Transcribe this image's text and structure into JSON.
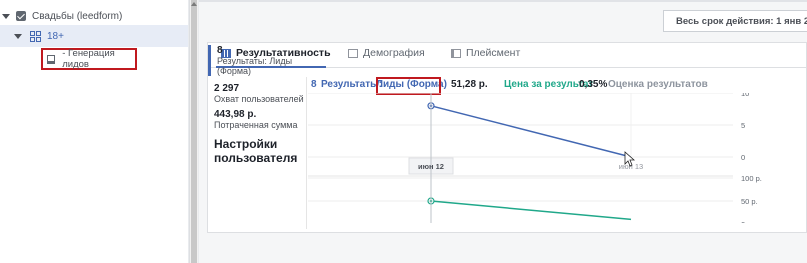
{
  "tree": {
    "campaign": "Свадьбы (leedform)",
    "adset": "18+",
    "ad": "- Генерация лидов"
  },
  "date_filter": "Весь срок действия: 1 янв 201",
  "tabs": [
    {
      "label": "Результативность",
      "active": true
    },
    {
      "label": "Демография",
      "active": false
    },
    {
      "label": "Плейсмент",
      "active": false
    }
  ],
  "metrics": [
    {
      "value": "8",
      "desc": "Результаты: Лиды (Форма)"
    },
    {
      "value": "2 297",
      "desc": "Охват пользователей"
    },
    {
      "value": "443,98 р.",
      "desc": "Потраченная сумма"
    }
  ],
  "user_settings": "Настройки пользователя",
  "chart_header": {
    "results_value": "8",
    "results_label_1": "Результаты:",
    "results_label_2": "Лиды (Форма)",
    "cost_value": "51,28 р.",
    "cost_label": "Цена за результат",
    "score_value": "0,35%",
    "score_label": "Оценка результатов"
  },
  "chart_data": [
    {
      "type": "line",
      "x": [
        "июн 12",
        "июн 13"
      ],
      "series": [
        {
          "values": [
            8,
            0
          ]
        }
      ],
      "ylim": [
        0,
        10
      ],
      "yticks": [
        "10",
        "5",
        "0"
      ],
      "color": "#4267b2"
    },
    {
      "type": "line",
      "x": [
        "июн 12",
        "июн 13"
      ],
      "series": [
        {
          "values": [
            50,
            10
          ]
        }
      ],
      "ylim": [
        0,
        100
      ],
      "yticks": [
        "100 р.",
        "50 р.",
        "0 р."
      ],
      "color": "#20a88a"
    }
  ],
  "colors": {
    "accent": "#4267b2",
    "green": "#20a88a",
    "highlight": "#c0191f"
  }
}
